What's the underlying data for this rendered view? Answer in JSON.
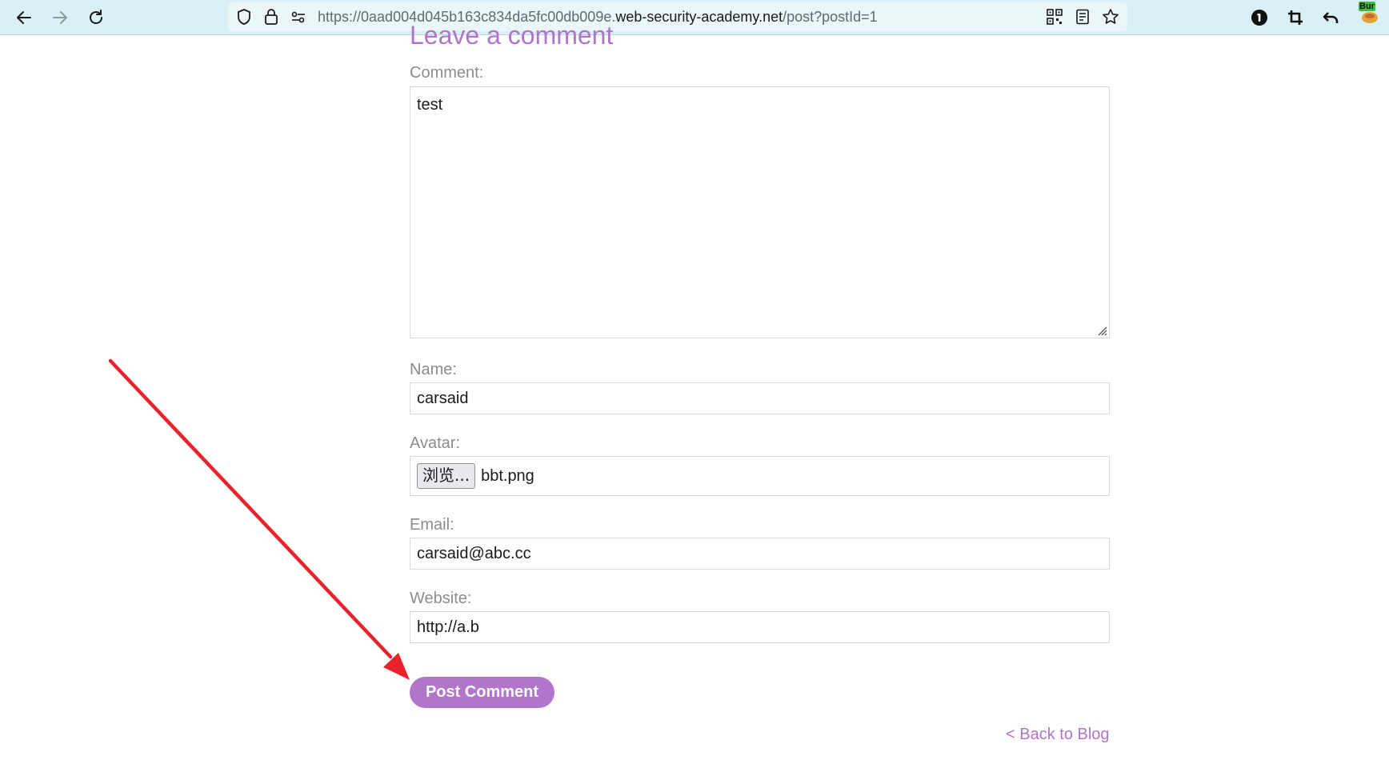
{
  "browser": {
    "url_prefix": "https://0aad004d045b163c834da5fc00db009e.",
    "url_domain": "web-security-academy.net",
    "url_suffix": "/post?postId=1",
    "extension_badge": "Bur"
  },
  "page": {
    "heading": "Leave a comment",
    "comment_label": "Comment:",
    "comment_value": "test",
    "name_label": "Name:",
    "name_value": "carsaid",
    "avatar_label": "Avatar:",
    "avatar_button": "浏览...",
    "avatar_file": "bbt.png",
    "email_label": "Email:",
    "email_value": "carsaid@abc.cc",
    "website_label": "Website:",
    "website_value": "http://a.b",
    "submit_label": "Post Comment",
    "back_link": "< Back to Blog"
  },
  "colors": {
    "accent": "#b176c9",
    "annotation_arrow": "#e8232b",
    "toolbar_bg": "#d9f1f5"
  }
}
